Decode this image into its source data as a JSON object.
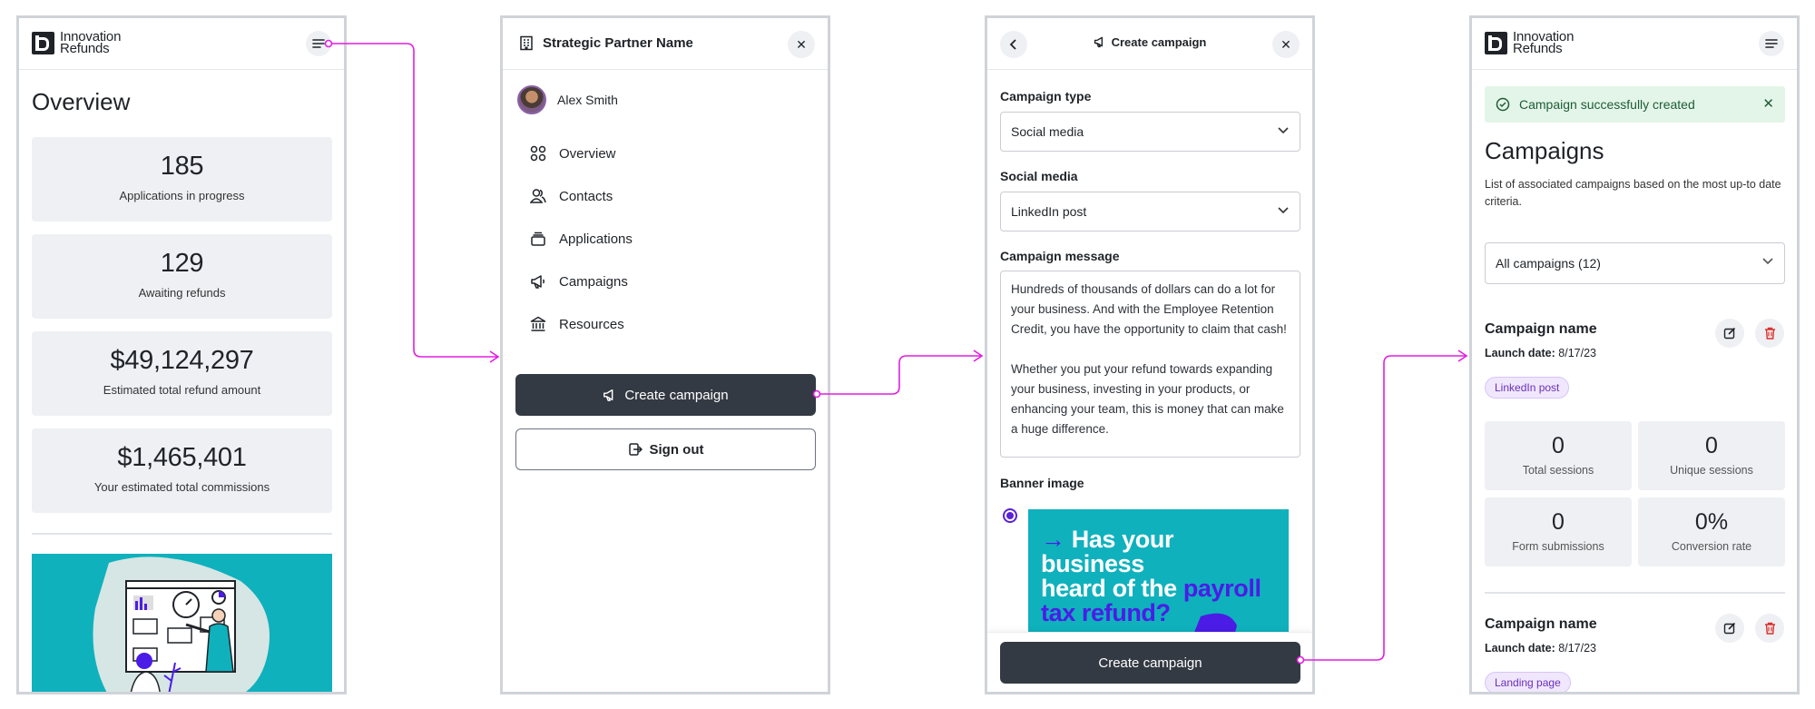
{
  "colors": {
    "connector": "#e21ee0",
    "dark_button": "#343a43",
    "accent_purple": "#5b21d6",
    "success_bg": "#e3f5e8",
    "teal": "#0fb1bd"
  },
  "logo": {
    "line1": "Innovation",
    "line2": "Refunds"
  },
  "screen1": {
    "title": "Overview",
    "stats": [
      {
        "value": "185",
        "label": "Applications in progress"
      },
      {
        "value": "129",
        "label": "Awaiting refunds"
      },
      {
        "value": "$49,124,297",
        "label": "Estimated total refund amount"
      },
      {
        "value": "$1,465,401",
        "label": "Your estimated total commissions"
      }
    ]
  },
  "screen2": {
    "partner_name": "Strategic Partner Name",
    "user_name": "Alex Smith",
    "nav": [
      {
        "label": "Overview",
        "icon": "grid-icon"
      },
      {
        "label": "Contacts",
        "icon": "users-icon"
      },
      {
        "label": "Applications",
        "icon": "inbox-icon"
      },
      {
        "label": "Campaigns",
        "icon": "megaphone-icon"
      },
      {
        "label": "Resources",
        "icon": "bank-icon"
      }
    ],
    "create_campaign_label": "Create campaign",
    "sign_out_label": "Sign out"
  },
  "screen3": {
    "title": "Create campaign",
    "campaign_type_label": "Campaign type",
    "campaign_type_value": "Social media",
    "social_media_label": "Social media",
    "social_media_value": "LinkedIn post",
    "message_label": "Campaign message",
    "message_value": "Hundreds of thousands of dollars can do a lot for your business. And with the Employee Retention Credit, you have the opportunity to claim that cash!\n\nWhether you put your refund towards expanding your business, investing in your products, or enhancing your team, this is money that can make a huge difference.",
    "banner_label": "Banner image",
    "banner": {
      "arrow": "→",
      "line1": "Has your business",
      "line2a": "heard of the ",
      "line2b": "payroll",
      "line3": "tax refund?"
    },
    "submit_label": "Create campaign"
  },
  "screen4": {
    "alert": "Campaign successfully created",
    "title": "Campaigns",
    "description": "List of associated campaigns based on the most up-to date criteria.",
    "filter_value": "All campaigns (12)",
    "campaigns": [
      {
        "name": "Campaign name",
        "launch_label": "Launch date:",
        "launch_date": "8/17/23",
        "tag": "LinkedIn post",
        "metrics": [
          {
            "value": "0",
            "label": "Total sessions"
          },
          {
            "value": "0",
            "label": "Unique sessions"
          },
          {
            "value": "0",
            "label": "Form submissions"
          },
          {
            "value": "0%",
            "label": "Conversion rate"
          }
        ]
      },
      {
        "name": "Campaign name",
        "launch_label": "Launch date:",
        "launch_date": "8/17/23",
        "tag": "Landing page"
      }
    ]
  }
}
